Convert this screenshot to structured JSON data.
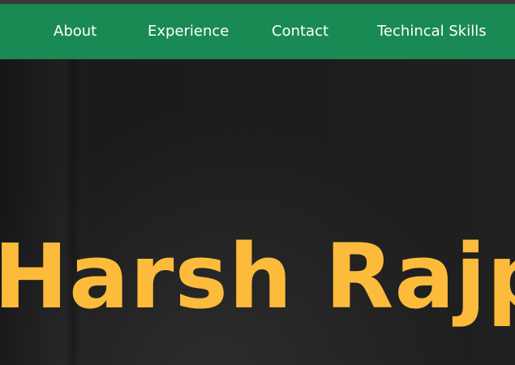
{
  "nav": {
    "items": [
      {
        "label": "About"
      },
      {
        "label": "Experience"
      },
      {
        "label": "Contact"
      },
      {
        "label": "Techincal Skills"
      }
    ]
  },
  "hero": {
    "name": "Harsh Rajpal"
  },
  "colors": {
    "navbar_bg": "#1a8a54",
    "nav_text": "#ffffff",
    "hero_bg": "#1c1c1c",
    "name_text": "#fdbb3c"
  }
}
